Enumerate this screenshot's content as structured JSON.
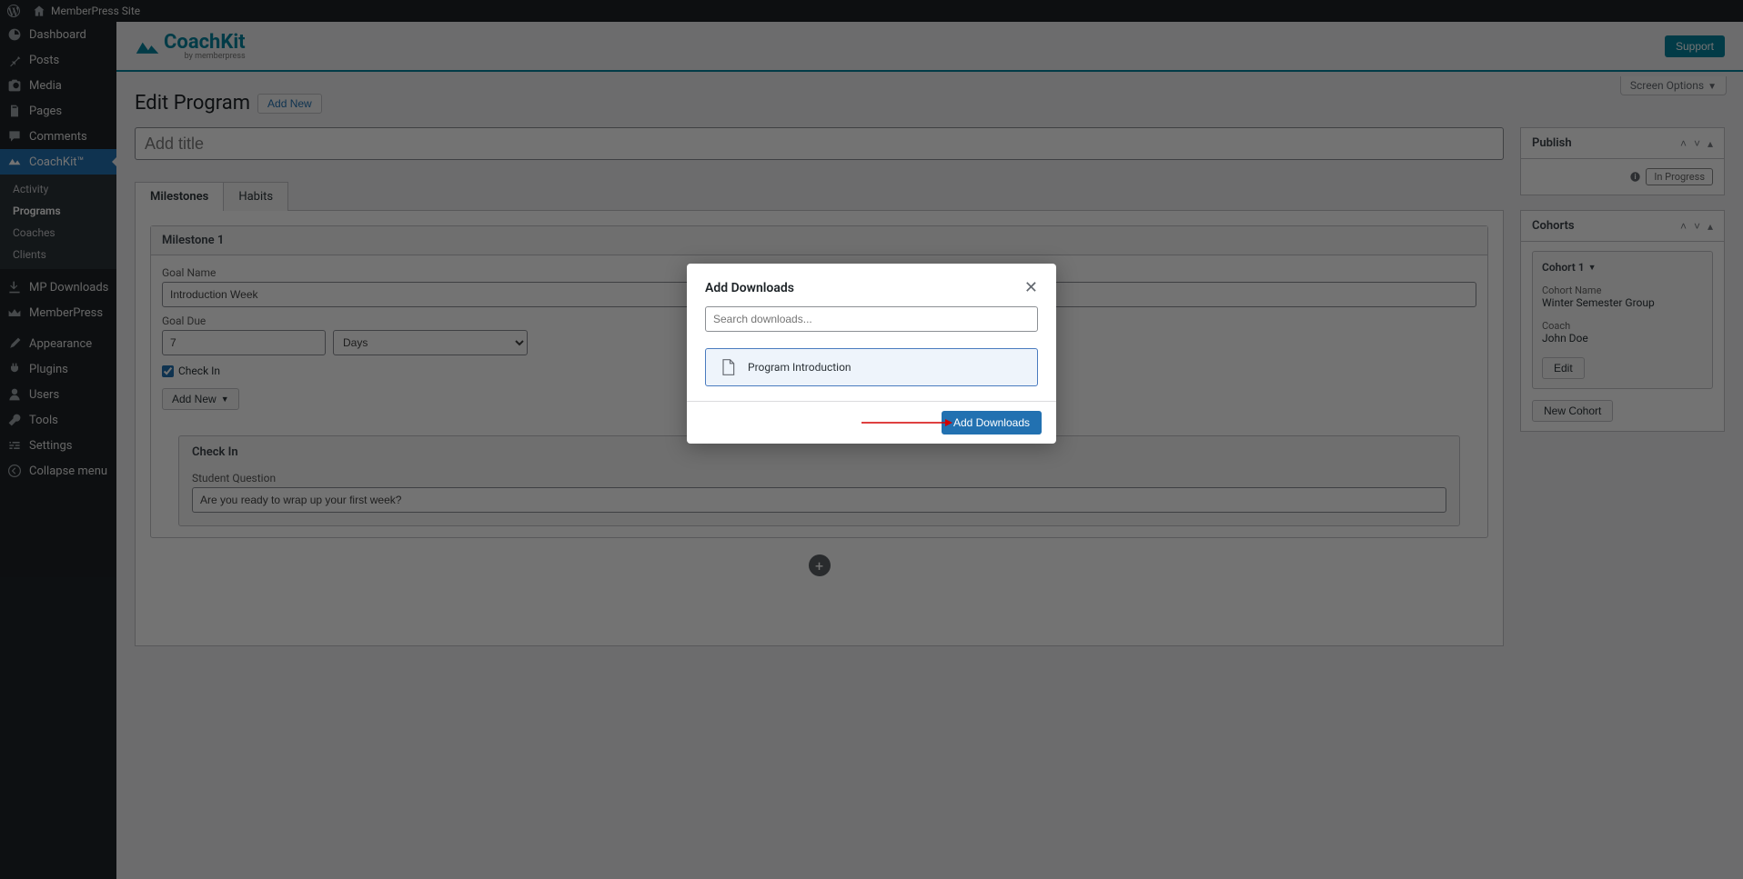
{
  "adminbar": {
    "site_name": "MemberPress Site"
  },
  "sidebar": {
    "dashboard": "Dashboard",
    "posts": "Posts",
    "media": "Media",
    "pages": "Pages",
    "comments": "Comments",
    "coachkit": "CoachKit™",
    "submenu": {
      "activity": "Activity",
      "programs": "Programs",
      "coaches": "Coaches",
      "clients": "Clients"
    },
    "mp_downloads": "MP Downloads",
    "memberpress": "MemberPress",
    "appearance": "Appearance",
    "plugins": "Plugins",
    "users": "Users",
    "tools": "Tools",
    "settings": "Settings",
    "collapse": "Collapse menu"
  },
  "brand": {
    "name": "CoachKit",
    "sub": "by memberpress",
    "support": "Support"
  },
  "screen_options": "Screen Options",
  "page": {
    "title": "Edit Program",
    "add_new": "Add New",
    "title_placeholder": "Add title"
  },
  "tabs": {
    "milestones": "Milestones",
    "habits": "Habits"
  },
  "milestone": {
    "header": "Milestone 1",
    "goal_name_label": "Goal Name",
    "goal_name_value": "Introduction Week",
    "goal_due_label": "Goal Due",
    "goal_due_value": "7",
    "goal_due_unit": "Days",
    "check_in_label": "Check In",
    "add_new": "Add New",
    "checkin_header": "Check In",
    "question_label": "Student Question",
    "question_value": "Are you ready to wrap up your first week?"
  },
  "publish": {
    "title": "Publish",
    "status": "In Progress"
  },
  "cohorts": {
    "title": "Cohorts",
    "card_title": "Cohort 1",
    "name_label": "Cohort Name",
    "name_value": "Winter Semester Group",
    "coach_label": "Coach",
    "coach_value": "John Doe",
    "edit": "Edit",
    "new": "New Cohort"
  },
  "modal": {
    "title": "Add Downloads",
    "search_placeholder": "Search downloads...",
    "item": "Program Introduction",
    "submit": "Add Downloads"
  }
}
